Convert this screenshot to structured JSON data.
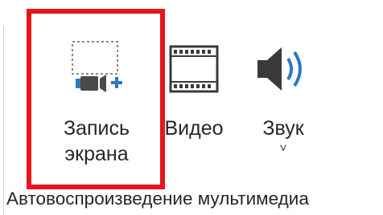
{
  "ribbon": {
    "commands": [
      {
        "id": "screen_recording",
        "label_line1": "Запись",
        "label_line2": "экрана",
        "icon": "screen-recording-icon"
      },
      {
        "id": "video",
        "label": "Видео",
        "icon": "video-film-icon"
      },
      {
        "id": "audio",
        "label": "Звук",
        "icon": "speaker-icon",
        "dropdown": "˅"
      }
    ],
    "group_label": "Автовоспроизведение мультимедиа",
    "highlight_color": "#e6141e",
    "accent_color": "#2b78c5"
  }
}
